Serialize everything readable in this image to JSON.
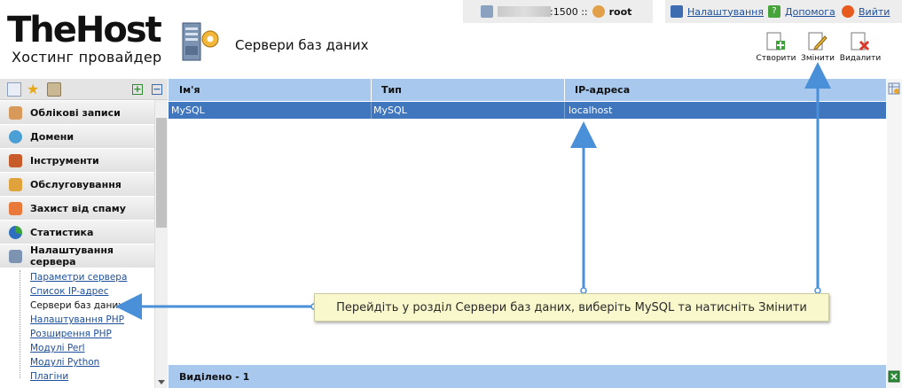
{
  "header": {
    "logo_title": "TheHost",
    "logo_subtitle": "Хостинг провайдер",
    "page_title": "Сервери баз даних",
    "session": {
      "port": ":1500 ::",
      "user": "root"
    },
    "links": {
      "settings": "Налаштування",
      "help": "Допомога",
      "logout": "Вийти"
    }
  },
  "toolbar": {
    "create": "Створити",
    "edit": "Змінити",
    "delete": "Видалити"
  },
  "sidebar": {
    "items": [
      {
        "label": "Облікові записи",
        "icon": "accounts-icon"
      },
      {
        "label": "Домени",
        "icon": "domains-icon"
      },
      {
        "label": "Інструменти",
        "icon": "tools-icon"
      },
      {
        "label": "Обслуговування",
        "icon": "maintenance-icon"
      },
      {
        "label": "Захист від спаму",
        "icon": "spam-shield-icon"
      },
      {
        "label": "Статистика",
        "icon": "statistics-icon"
      },
      {
        "label": "Налаштування сервера",
        "icon": "server-settings-icon"
      }
    ],
    "subitems": [
      "Параметри сервера",
      "Список IP-адрес",
      "Сервери баз даних",
      "Налаштування PHP",
      "Розширення PHP",
      "Модулі Perl",
      "Модулі Python",
      "Плагіни"
    ]
  },
  "grid": {
    "columns": [
      "Ім'я",
      "Тип",
      "IP-адреса"
    ],
    "rows": [
      {
        "name": "MySQL",
        "type": "MySQL",
        "ip": "localhost"
      }
    ],
    "footer": "Виділено - 1"
  },
  "annotation": {
    "text": "Перейдіть у розділ Сервери баз даних, виберіть MySQL та натисніть Змінити"
  },
  "colors": {
    "header_blue": "#a8c8ee",
    "selected_row": "#3f76be",
    "link": "#1d4f9c",
    "arrow": "#4a90d9",
    "callout_bg": "#f8f8cc"
  }
}
